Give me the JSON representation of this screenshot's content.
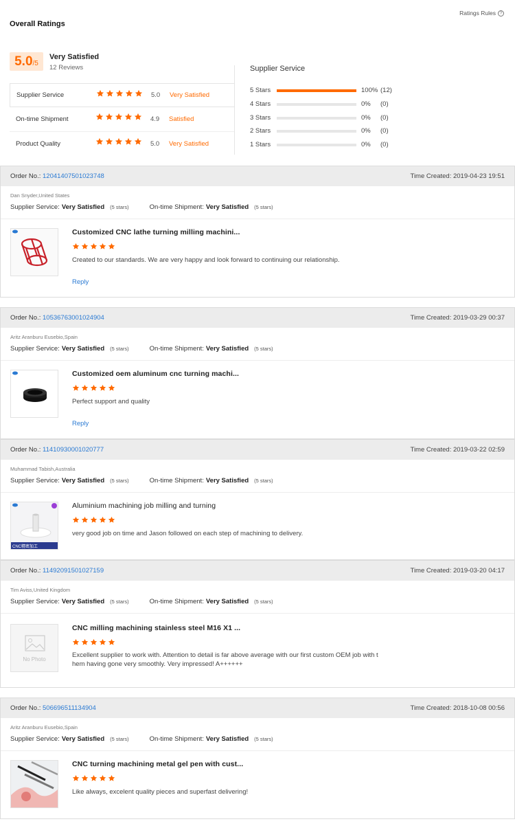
{
  "overall": {
    "title": "Overall Ratings",
    "rules_label": "Ratings Rules",
    "score": "5.0",
    "score_max": "/5",
    "summary": "Very Satisfied",
    "reviews": "12 Reviews",
    "criteria": [
      {
        "name": "Supplier Service",
        "score": "5.0",
        "word": "Very Satisfied",
        "stars": 5
      },
      {
        "name": "On-time Shipment",
        "score": "4.9",
        "word": "Satisfied",
        "stars": 5
      },
      {
        "name": "Product Quality",
        "score": "5.0",
        "word": "Very Satisfied",
        "stars": 5
      }
    ],
    "distribution_title": "Supplier Service",
    "distribution": [
      {
        "label": "5  Stars",
        "pct": "100%",
        "count": "(12)",
        "fraction": 1.0
      },
      {
        "label": "4  Stars",
        "pct": "0%",
        "count": "(0)",
        "fraction": 0
      },
      {
        "label": "3  Stars",
        "pct": "0%",
        "count": "(0)",
        "fraction": 0
      },
      {
        "label": "2  Stars",
        "pct": "0%",
        "count": "(0)",
        "fraction": 0
      },
      {
        "label": "1  Stars",
        "pct": "0%",
        "count": "(0)",
        "fraction": 0
      }
    ]
  },
  "labels": {
    "order_no": "Order No.:",
    "time_created": "Time Created:",
    "supplier_service": "Supplier Service:",
    "ontime_shipment": "On-time Shipment:",
    "reply": "Reply",
    "no_photo": "No Photo"
  },
  "colors": {
    "accent": "#ff6a00",
    "link": "#2a7ad3",
    "header_bg": "#ececec"
  },
  "reviews": [
    {
      "order_no": "12041407501023748",
      "time": "2019-04-23 19:51",
      "buyer": "Dan Snyder,United States",
      "supplier_service": "Very Satisfied",
      "supplier_stars": "(5 stars)",
      "shipment": "Very Satisfied",
      "shipment_stars": "(5 stars)",
      "product": "Customized CNC lathe turning milling machini...",
      "stars": 5,
      "text": "Created to our standards. We are very happy and look forward to continuing our relationship.",
      "has_reply": true,
      "thumb": "red-part"
    },
    {
      "order_no": "10536763001024904",
      "time": "2019-03-29 00:37",
      "buyer": "Aritz Aranburu Eusebio,Spain",
      "supplier_service": "Very Satisfied",
      "supplier_stars": "(5 stars)",
      "shipment": "Very Satisfied",
      "shipment_stars": "(5 stars)",
      "product": "Customized oem aluminum cnc turning machi...",
      "stars": 5,
      "text": "Perfect support and quality",
      "has_reply": true,
      "thumb": "black-ring"
    },
    {
      "order_no": "11410930001020777",
      "time": "2019-03-22 02:59",
      "buyer": "Muhammad Tabish,Australia",
      "supplier_service": "Very Satisfied",
      "supplier_stars": "(5 stars)",
      "shipment": "Very Satisfied",
      "shipment_stars": "(5 stars)",
      "product": "Aluminium machining job milling and turning",
      "stars": 5,
      "text": "very good job on time and Jason followed on each step of machining to delivery.",
      "has_reply": false,
      "thumb": "white-part",
      "thumb_banner": "CNC精密加工"
    },
    {
      "order_no": "11492091501027159",
      "time": "2019-03-20 04:17",
      "buyer": "Tim Aviss,United Kingdom",
      "supplier_service": "Very Satisfied",
      "supplier_stars": "(5 stars)",
      "shipment": "Very Satisfied",
      "shipment_stars": "(5 stars)",
      "product": "CNC milling machining stainless steel M16 X1 ...",
      "stars": 5,
      "text": "Excellent supplier to work with. Attention to detail is far above average with our first custom OEM job with t hem having gone very smoothly. Very impressed! A++++++",
      "has_reply": false,
      "thumb": "no-photo"
    },
    {
      "order_no": "506696511134904",
      "time": "2018-10-08 00:56",
      "buyer": "Aritz Aranburu Eusebio,Spain",
      "supplier_service": "Very Satisfied",
      "supplier_stars": "(5 stars)",
      "shipment": "Very Satisfied",
      "shipment_stars": "(5 stars)",
      "product": "CNC turning machining metal gel pen with cust...",
      "stars": 5,
      "text": "Like always, excelent quality pieces and superfast delivering!",
      "has_reply": false,
      "thumb": "pen"
    }
  ]
}
